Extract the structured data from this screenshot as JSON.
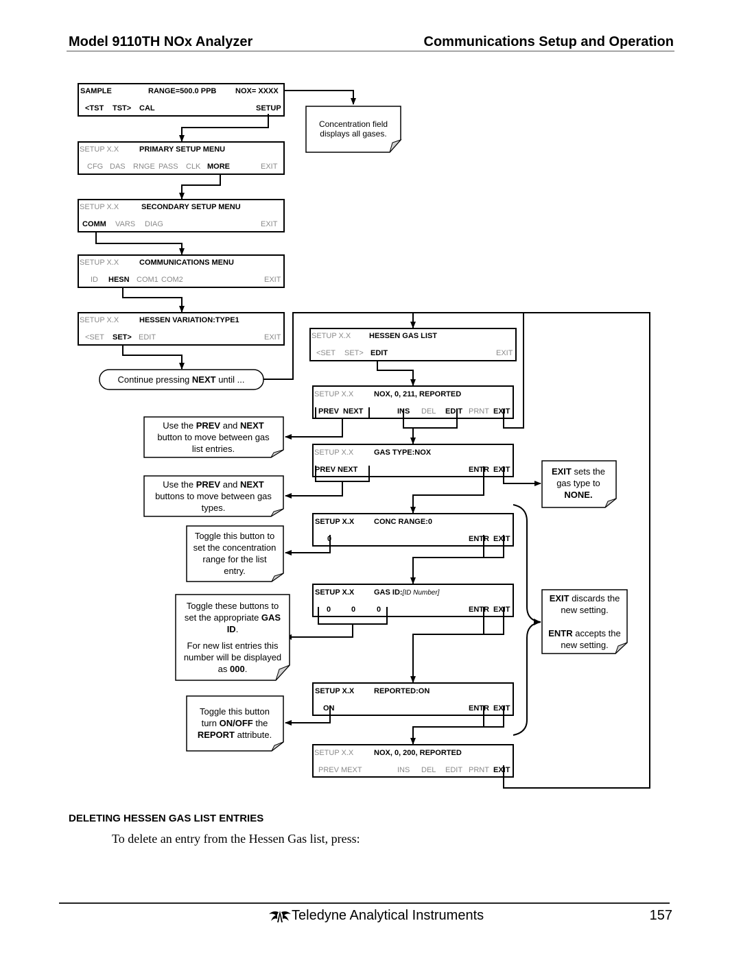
{
  "header": {
    "left": "Model 9110TH NOx Analyzer",
    "right": "Communications Setup and Operation"
  },
  "screens": {
    "sample": {
      "r1": {
        "a": "SAMPLE",
        "b": "RANGE=500.0 PPB",
        "c": "NOX= XXXX"
      },
      "r2": {
        "tst_prev": "<TST",
        "tst_next": "TST>",
        "cal": "CAL",
        "setup": "SETUP"
      }
    },
    "primary": {
      "r1": {
        "a": "SETUP X.X",
        "b": "PRIMARY SETUP MENU"
      },
      "r2": {
        "cfg": "CFG",
        "das": "DAS",
        "rnge": "RNGE",
        "pass": "PASS",
        "clk": "CLK",
        "more": "MORE",
        "exit": "EXIT"
      }
    },
    "secondary": {
      "r1": {
        "a": "SETUP X.X",
        "b": "SECONDARY SETUP MENU"
      },
      "r2": {
        "comm": "COMM",
        "vars": "VARS",
        "diag": "DIAG",
        "exit": "EXIT"
      }
    },
    "comm": {
      "r1": {
        "a": "SETUP X.X",
        "b": "COMMUNICATIONS MENU"
      },
      "r2": {
        "id": "ID",
        "hesn": "HESN",
        "com1": "COM1",
        "com2": "COM2",
        "exit": "EXIT"
      }
    },
    "hessen_var": {
      "r1": {
        "a": "SETUP X.X",
        "b": "HESSEN VARIATION:TYPE1"
      },
      "r2": {
        "set_prev": "<SET",
        "set_next": "SET>",
        "edit": "EDIT",
        "exit": "EXIT"
      }
    },
    "gas_list": {
      "r1": {
        "a": "SETUP X.X",
        "b": "HESSEN GAS LIST"
      },
      "r2": {
        "set_prev": "<SET",
        "set_next": "SET>",
        "edit": "EDIT",
        "exit": "EXIT"
      }
    },
    "entry1": {
      "r1": {
        "a": "SETUP X.X",
        "b": "NOX, 0, 211, REPORTED"
      },
      "r2": {
        "prev": "PREV",
        "next": "NEXT",
        "ins": "INS",
        "del": "DEL",
        "edit": "EDIT",
        "prnt": "PRNT",
        "exit": "EXIT"
      }
    },
    "gas_type": {
      "r1": {
        "a": "SETUP X.X",
        "b": "GAS TYPE:NOX"
      },
      "r2": {
        "prev_next": "PREV NEXT",
        "entr": "ENTR",
        "exit": "EXIT"
      }
    },
    "conc_range": {
      "r1": {
        "a": "SETUP X.X",
        "b": "CONC RANGE:0"
      },
      "r2": {
        "val": "0",
        "entr": "ENTR",
        "exit": "EXIT"
      }
    },
    "gas_id": {
      "r1": {
        "a": "SETUP X.X",
        "b": "GAS ID:",
        "b_italic": "[ID Number]"
      },
      "r2": {
        "d1": "0",
        "d2": "0",
        "d3": "0",
        "entr": "ENTR",
        "exit": "EXIT"
      }
    },
    "reported": {
      "r1": {
        "a": "SETUP X.X",
        "b": "REPORTED:ON"
      },
      "r2": {
        "on": "ON",
        "entr": "ENTR",
        "exit": "EXIT"
      }
    },
    "entry2": {
      "r1": {
        "a": "SETUP X.X",
        "b": "NOX, 0, 200, REPORTED"
      },
      "r2": {
        "prev_next": "PREV MEXT",
        "ins": "INS",
        "del": "DEL",
        "edit": "EDIT",
        "prnt": "PRNT",
        "exit": "EXIT"
      }
    }
  },
  "notes": {
    "conc_field": [
      "Concentration field",
      "displays all gases."
    ],
    "continue": {
      "pre": "Continue pressing ",
      "bold": "NEXT",
      "post": " until ..."
    },
    "prev_next_entries": {
      "l1_pre": "Use the ",
      "l1_b1": "PREV",
      "l1_mid": " and ",
      "l1_b2": "NEXT",
      "l2": "button to move between gas",
      "l3": "list entries."
    },
    "prev_next_types": {
      "l1_pre": "Use the ",
      "l1_b1": "PREV",
      "l1_mid": " and ",
      "l1_b2": "NEXT",
      "l2": "buttons to move between gas",
      "l3": "types."
    },
    "exit_none": {
      "l1_b": "EXIT",
      "l1": " sets the",
      "l2": "gas type to",
      "l3_b": "NONE."
    },
    "toggle_range": [
      "Toggle this button to",
      "set the concentration",
      "range for the list",
      "entry."
    ],
    "toggle_gas_id": {
      "l1": "Toggle these buttons to",
      "l2_pre": "set the appropriate ",
      "l2_b": "GAS",
      "l3_b": "ID",
      "l3": ".",
      "l4": "For new list entries this",
      "l5": "number will be displayed",
      "l6_pre": "as ",
      "l6_b": "000",
      "l6_post": "."
    },
    "exit_entr": {
      "l1_b": "EXIT",
      "l1": " discards the",
      "l2": "new setting.",
      "l3_b": "ENTR",
      "l3": " accepts the",
      "l4": "new setting."
    },
    "toggle_report": {
      "l1": "Toggle this button",
      "l2_pre": "turn ",
      "l2_b": "ON/OFF",
      "l2_post": " the",
      "l3_b": "REPORT",
      "l3_post": " attribute."
    }
  },
  "section_title": "DELETING HESSEN GAS LIST ENTRIES",
  "body_text": "To delete an entry from the Hessen Gas list, press:",
  "footer": {
    "logo_icon": "teledyne-logo-icon",
    "company": "Teledyne Analytical Instruments",
    "page_number": "157"
  }
}
